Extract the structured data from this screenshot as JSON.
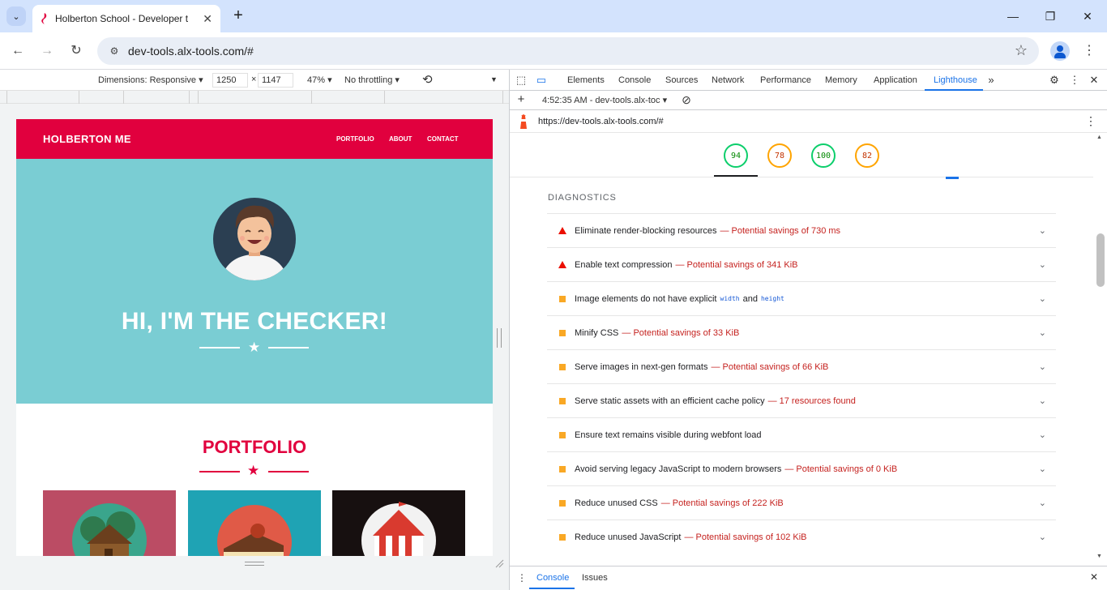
{
  "browser": {
    "tab_title": "Holberton School - Developer t",
    "url": "dev-tools.alx-tools.com/#"
  },
  "device_toolbar": {
    "dimensions_label": "Dimensions: Responsive ▾",
    "width_value": "1250",
    "times": "×",
    "height_value": "1147",
    "zoom": "47% ▾",
    "throttling": "No throttling ▾"
  },
  "site": {
    "brand": "HOLBERTON ME",
    "nav": [
      "PORTFOLIO",
      "ABOUT",
      "CONTACT"
    ],
    "hero_title": "HI, I'M THE CHECKER!",
    "section_title": "PORTFOLIO"
  },
  "devtools": {
    "tabs": [
      "Elements",
      "Console",
      "Sources",
      "Network",
      "Performance",
      "Memory",
      "Application",
      "Lighthouse"
    ],
    "report_label": "4:52:35 AM - dev-tools.alx-toc ▾",
    "report_url": "https://dev-tools.alx-tools.com/#",
    "scores": [
      {
        "value": "94",
        "status": "pass"
      },
      {
        "value": "78",
        "status": "average"
      },
      {
        "value": "100",
        "status": "pass"
      },
      {
        "value": "82",
        "status": "average"
      }
    ],
    "diagnostics_title": "DIAGNOSTICS",
    "audits": [
      {
        "title": "Eliminate render-blocking resources",
        "savings": "— Potential savings of 730 ms",
        "severity": "fail"
      },
      {
        "title": "Enable text compression",
        "savings": "— Potential savings of 341 KiB",
        "severity": "fail"
      },
      {
        "title": "Image elements do not have explicit",
        "code1": "width",
        "and": "and",
        "code2": "height",
        "savings": "",
        "severity": "average"
      },
      {
        "title": "Minify CSS",
        "savings": "— Potential savings of 33 KiB",
        "severity": "average"
      },
      {
        "title": "Serve images in next-gen formats",
        "savings": "— Potential savings of 66 KiB",
        "severity": "average"
      },
      {
        "title": "Serve static assets with an efficient cache policy",
        "savings": "— 17 resources found",
        "severity": "average"
      },
      {
        "title": "Ensure text remains visible during webfont load",
        "savings": "",
        "severity": "average"
      },
      {
        "title": "Avoid serving legacy JavaScript to modern browsers",
        "savings": "— Potential savings of 0 KiB",
        "severity": "average"
      },
      {
        "title": "Reduce unused CSS",
        "savings": "— Potential savings of 222 KiB",
        "severity": "average"
      },
      {
        "title": "Reduce unused JavaScript",
        "savings": "— Potential savings of 102 KiB",
        "severity": "average"
      }
    ],
    "drawer_tabs": [
      "Console",
      "Issues"
    ]
  },
  "colors": {
    "brand_red": "#e1003e",
    "hero_teal": "#7acdd3",
    "pass": "#0cce6b",
    "average": "#ffa400",
    "fail": "#eb0f00"
  }
}
